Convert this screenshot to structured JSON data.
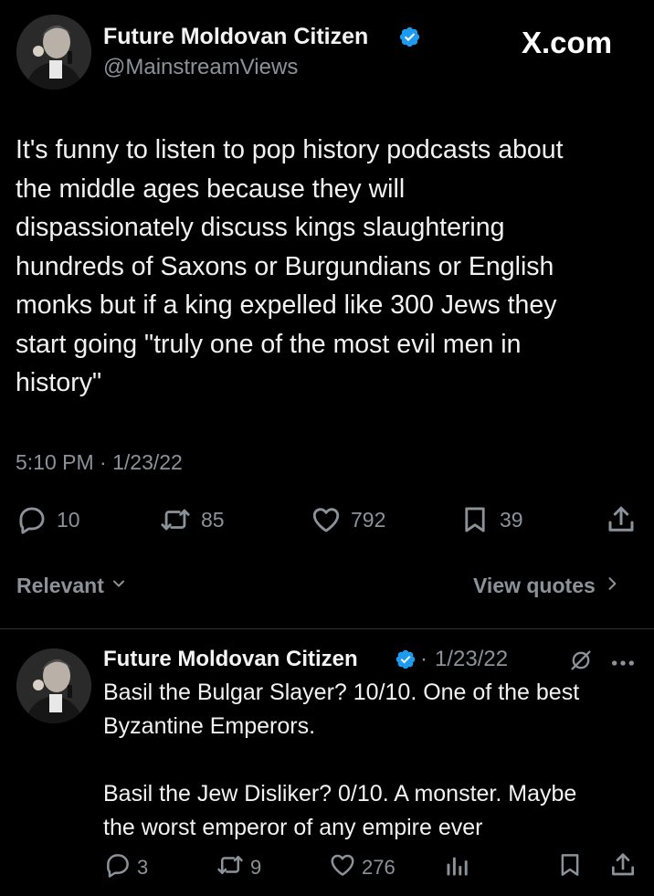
{
  "brand": {
    "label": "X.com"
  },
  "tweet": {
    "author_name": "Future Moldovan Citizen",
    "author_handle": "@MainstreamViews",
    "text": "It's funny to listen to pop history podcasts about\nthe middle ages because they will\ndispassionately discuss kings slaughtering\nhundreds of Saxons or Burgundians or English\nmonks but if a king expelled like 300 Jews they\nstart going \"truly one of the most evil men in\nhistory\"",
    "timestamp": "5:10 PM · 1/23/22",
    "stats": {
      "replies": "10",
      "retweets": "85",
      "likes": "792",
      "bookmarks": "39"
    }
  },
  "sort": {
    "label": "Relevant",
    "view_quotes_label": "View quotes"
  },
  "reply": {
    "author_name": "Future Moldovan Citizen",
    "separator": "·",
    "date": "1/23/22",
    "text": "Basil the Bulgar Slayer? 10/10. One of the best\nByzantine Emperors.\n\nBasil the Jew Disliker? 0/10. A monster. Maybe\nthe worst emperor of any empire ever",
    "stats": {
      "replies": "3",
      "retweets": "9",
      "likes": "276"
    }
  },
  "colors": {
    "background": "#000000",
    "text": "#e7e9ea",
    "muted": "#8b9299",
    "verified": "#1d9bf0",
    "divider": "#2f3336"
  },
  "icons": {
    "verified": "verified-badge-icon",
    "reply": "speech-bubble-icon",
    "retweet": "retweet-icon",
    "like": "heart-icon",
    "bookmark": "bookmark-icon",
    "share": "share-icon",
    "chevron_down": "chevron-down-icon",
    "chevron_right": "chevron-right-icon",
    "grok": "grok-icon",
    "more": "more-icon",
    "views": "analytics-icon"
  }
}
